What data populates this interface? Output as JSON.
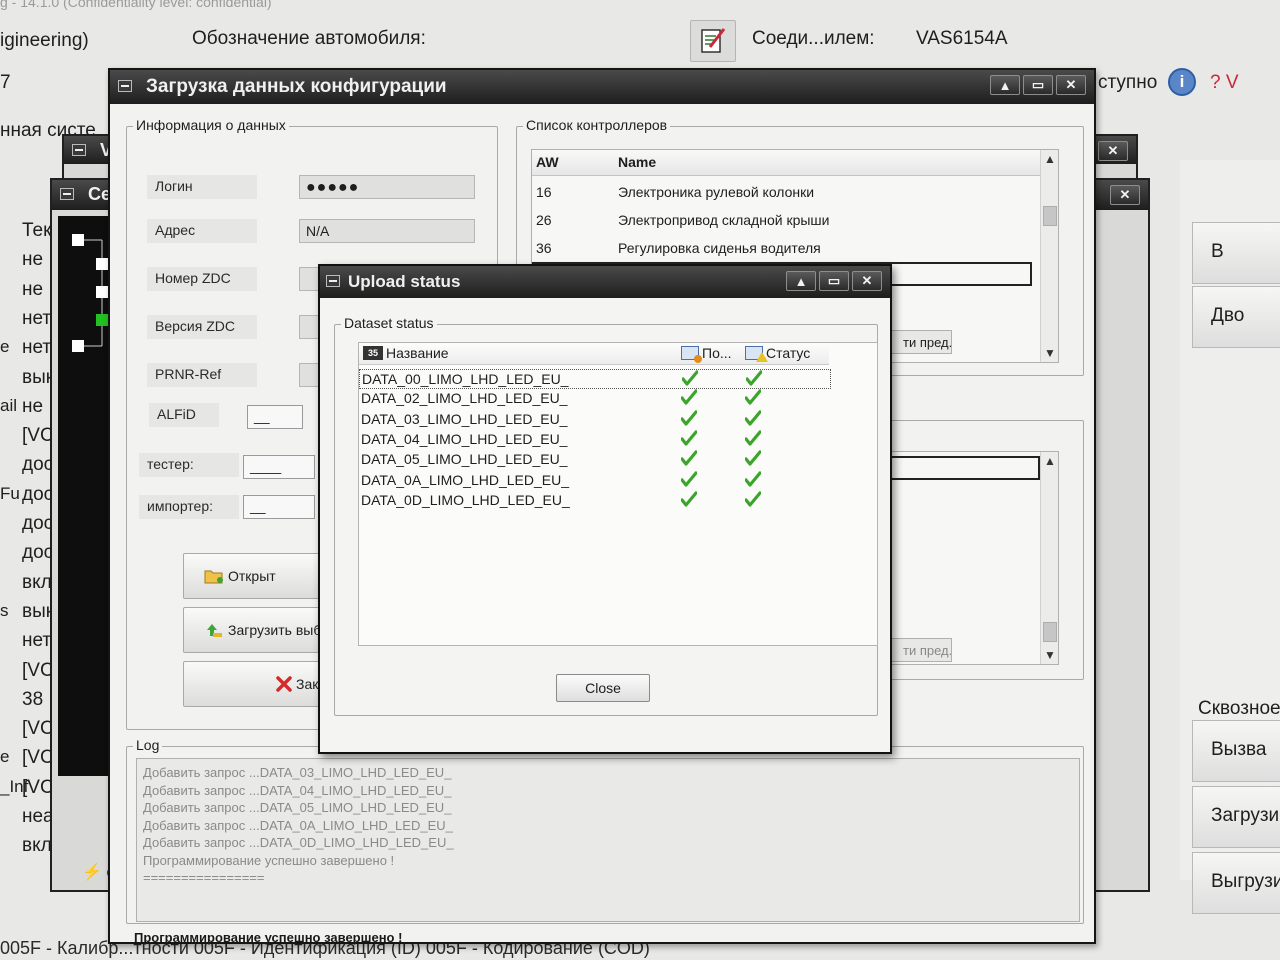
{
  "app": {
    "title_line": "g - 14.1.0 (Confidentiality level: confidential)",
    "mode": "igineering)",
    "vehicle_label": "Обозначение автомобиля:",
    "connection_label": "Соеди...илем:",
    "connection_value": "VAS6154A",
    "left_number": "7",
    "system_fragment": "нная систе",
    "availability_fragment": "ступно",
    "help_label": "? V"
  },
  "right_panel": {
    "btn1": "В",
    "btn2": "Дво",
    "label_through": "Сквозное",
    "btn3": "Вызва",
    "btn4": "Загрузи",
    "btn5": "Выгрузи"
  },
  "bg_list": [
    "Тек",
    "не",
    "не",
    "нет",
    "нет",
    "вык",
    "не",
    "[VC",
    "дос",
    "дос",
    "дос",
    "дос",
    "вкл",
    "вык",
    "нет",
    "[VC",
    "38",
    "[VC",
    "[VC",
    "[VC",
    "неа",
    "вкл."
  ],
  "bg_list_prefix": [
    "",
    "",
    "",
    "",
    "e",
    "",
    "ail",
    "",
    "",
    "Fu",
    "",
    "",
    "",
    "s",
    "",
    "",
    "",
    "",
    "e",
    "_Inf",
    "",
    ""
  ],
  "bg_windows": {
    "back1_title": "V",
    "back2_title": "Сер",
    "back_status": "с"
  },
  "bottom_tabs": "005F - Калибр...тности      005F - Идентификация (ID)      005F - Кодирование (COD)",
  "config_window": {
    "title": "Загрузка данных конфигурации",
    "info_group": "Информация о данных",
    "fields": [
      {
        "label": "Логин",
        "value": "●●●●●"
      },
      {
        "label": "Адрес",
        "value": "N/A"
      },
      {
        "label": "Номер ZDC",
        "value": ""
      },
      {
        "label": "Версия ZDC",
        "value": ""
      },
      {
        "label": "PRNR-Ref",
        "value": ""
      }
    ],
    "alfid_label": "ALFiD",
    "alfid_value": "__",
    "tester_label": "тестер:",
    "tester_value": "____",
    "importer_label": "импортер:",
    "importer_value": "__",
    "buttons": {
      "open": "Открыт",
      "upload_selected": "Загрузить выб",
      "close": "Закр"
    },
    "controllers_group": "Список контроллеров",
    "controllers_headers": {
      "aw": "AW",
      "name": "Name"
    },
    "controllers": [
      {
        "aw": "16",
        "name": "Электроника рулевой колонки"
      },
      {
        "aw": "26",
        "name": "Электропривод складной крыши"
      },
      {
        "aw": "36",
        "name": "Регулировка сиденья водителя"
      }
    ],
    "prev_button_1": "ти пред.",
    "prev_button_2": "ти пред.",
    "log_group": "Log",
    "log_lines": [
      "Добавить запрос ...DATA_03_LIMO_LHD_LED_EU_",
      "Добавить запрос ...DATA_04_LIMO_LHD_LED_EU_",
      "Добавить запрос ...DATA_05_LIMO_LHD_LED_EU_",
      "Добавить запрос ...DATA_0A_LIMO_LHD_LED_EU_",
      "Добавить запрос ...DATA_0D_LIMO_LHD_LED_EU_",
      "Программирование успешно завершено !",
      "================"
    ],
    "status_text": "Программирование успешно завершено !",
    "right_fragment": "на"
  },
  "upload_dialog": {
    "title": "Upload status",
    "group": "Dataset status",
    "headers": {
      "name": "Название",
      "po": "По...",
      "status": "Статус"
    },
    "datasets": [
      {
        "name": "DATA_00_LIMO_LHD_LED_EU_",
        "po_ok": true,
        "status_ok": true
      },
      {
        "name": "DATA_02_LIMO_LHD_LED_EU_",
        "po_ok": true,
        "status_ok": true
      },
      {
        "name": "DATA_03_LIMO_LHD_LED_EU_",
        "po_ok": true,
        "status_ok": true
      },
      {
        "name": "DATA_04_LIMO_LHD_LED_EU_",
        "po_ok": true,
        "status_ok": true
      },
      {
        "name": "DATA_05_LIMO_LHD_LED_EU_",
        "po_ok": true,
        "status_ok": true
      },
      {
        "name": "DATA_0A_LIMO_LHD_LED_EU_",
        "po_ok": true,
        "status_ok": true
      },
      {
        "name": "DATA_0D_LIMO_LHD_LED_EU_",
        "po_ok": true,
        "status_ok": true
      }
    ],
    "close_button": "Close",
    "num_badge": "35"
  },
  "window_buttons": {
    "min": "▲",
    "max": "▭",
    "close": "✕"
  },
  "colors": {
    "check": "#3aa52a",
    "accent": "#5a86c8",
    "help": "#c8283a"
  }
}
